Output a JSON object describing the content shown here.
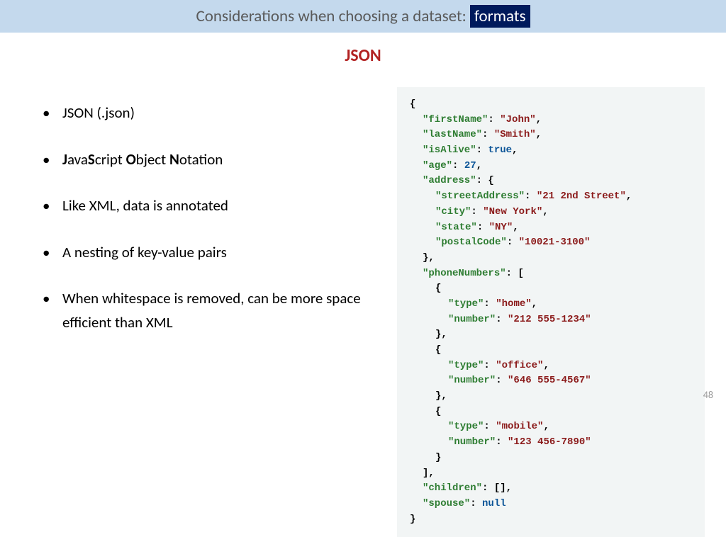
{
  "header": {
    "prefix": "Considerations when choosing a dataset: ",
    "highlight_partial_inside": "fo",
    "highlight_rest": "rmats"
  },
  "subtitle": "JSON",
  "bullets": [
    {
      "plain": "JSON (.json)"
    },
    {
      "parts": [
        "J",
        "ava",
        "S",
        "cript ",
        "O",
        "bject ",
        "N",
        "otation"
      ],
      "boldIdx": [
        0,
        2,
        4,
        6
      ]
    },
    {
      "plain": "Like XML, data is annotated"
    },
    {
      "plain": "A nesting of key-value pairs"
    },
    {
      "plain": "When whitespace is removed, can be more space efficient than XML"
    }
  ],
  "code": {
    "firstName": "John",
    "lastName": "Smith",
    "isAlive": "true",
    "age": "27",
    "address": {
      "streetAddress": "21 2nd Street",
      "city": "New York",
      "state": "NY",
      "postalCode": "10021-3100"
    },
    "phoneNumbers": [
      {
        "type": "home",
        "number": "212 555-1234"
      },
      {
        "type": "office",
        "number": "646 555-4567"
      },
      {
        "type": "mobile",
        "number": "123 456-7890"
      }
    ],
    "children": "[]",
    "spouse": "null"
  },
  "pageNumber": "48"
}
